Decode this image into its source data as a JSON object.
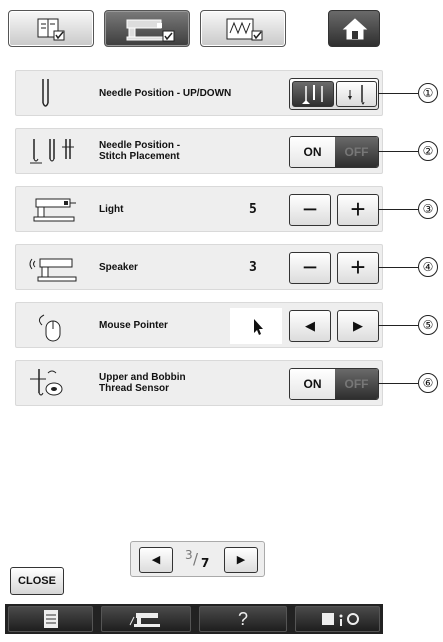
{
  "tabs": [
    {
      "icon": "settings-general-icon",
      "active": false
    },
    {
      "icon": "settings-machine-icon",
      "active": true
    },
    {
      "icon": "settings-embroidery-icon",
      "active": false
    }
  ],
  "home_icon": "home-icon",
  "rows": [
    {
      "label": "Needle Position - UP/DOWN",
      "callout": "①",
      "icon": "needle-up-down-icon"
    },
    {
      "label": "Needle Position -\nStitch Placement",
      "callout": "②",
      "on_label": "ON",
      "off_label": "OFF",
      "icon": "needle-placement-icon"
    },
    {
      "label": "Light",
      "value": "5",
      "callout": "③",
      "minus": "−",
      "plus": "+",
      "icon": "machine-light-icon"
    },
    {
      "label": "Speaker",
      "value": "3",
      "callout": "④",
      "minus": "−",
      "plus": "+",
      "icon": "speaker-icon"
    },
    {
      "label": "Mouse Pointer",
      "callout": "⑤",
      "left": "◀",
      "right": "▶",
      "icon": "mouse-icon"
    },
    {
      "label": "Upper and Bobbin\nThread Sensor",
      "callout": "⑥",
      "on_label": "ON",
      "off_label": "OFF",
      "icon": "thread-sensor-icon"
    }
  ],
  "pager": {
    "current": "3",
    "total": "7",
    "prev": "◀",
    "next": "▶"
  },
  "close_label": "CLOSE",
  "bottom_bar": {
    "help_label": "?"
  }
}
